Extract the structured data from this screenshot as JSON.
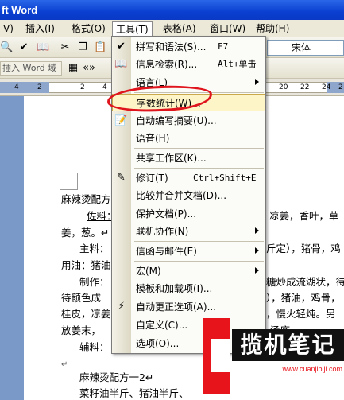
{
  "window": {
    "title": "ft Word"
  },
  "menubar": {
    "items": [
      {
        "label": "V)"
      },
      {
        "label": "插入(I)"
      },
      {
        "label": "格式(O)"
      },
      {
        "label": "工具(T)"
      },
      {
        "label": "表格(A)"
      },
      {
        "label": "窗口(W)"
      },
      {
        "label": "帮助(H)"
      }
    ]
  },
  "toolbar": {
    "font_name": "宋体",
    "insert_field_label": "插入 Word 域 ▾"
  },
  "ruler": {
    "left_ticks": [
      "4",
      "2"
    ],
    "marks": [
      "2",
      "4"
    ],
    "right_ticks": [
      "20",
      "22",
      "24",
      "2"
    ]
  },
  "tools_menu": {
    "items": [
      {
        "icon": "spelling-icon",
        "label": "拼写和语法(S)...",
        "shortcut": "F7"
      },
      {
        "icon": "research-icon",
        "label": "信息检索(R)...",
        "shortcut": "Alt+单击"
      },
      {
        "icon": "",
        "label": "语言(L)",
        "shortcut": "",
        "submenu": true
      },
      {
        "icon": "",
        "label": "字数统计(W)...",
        "shortcut": ""
      },
      {
        "icon": "autosummarize-icon",
        "label": "自动编写摘要(U)...",
        "shortcut": ""
      },
      {
        "icon": "",
        "label": "语音(H)",
        "shortcut": ""
      },
      {
        "icon": "",
        "label": "共享工作区(K)...",
        "shortcut": ""
      },
      {
        "icon": "track-changes-icon",
        "label": "修订(T)",
        "shortcut": "Ctrl+Shift+E"
      },
      {
        "icon": "",
        "label": "比较并合并文档(D)...",
        "shortcut": ""
      },
      {
        "icon": "",
        "label": "保护文档(P)...",
        "shortcut": ""
      },
      {
        "icon": "",
        "label": "联机协作(N)",
        "shortcut": "",
        "submenu": true
      },
      {
        "icon": "",
        "label": "信函与邮件(E)",
        "shortcut": "",
        "submenu": true
      },
      {
        "icon": "",
        "label": "宏(M)",
        "shortcut": "",
        "submenu": true
      },
      {
        "icon": "",
        "label": "模板和加载项(I)...",
        "shortcut": ""
      },
      {
        "icon": "autocorrect-icon",
        "label": "自动更正选项(A)...",
        "shortcut": ""
      },
      {
        "icon": "",
        "label": "自定义(C)...",
        "shortcut": ""
      },
      {
        "icon": "",
        "label": "选项(O)...",
        "shortcut": ""
      }
    ]
  },
  "document": {
    "lines": [
      "麻辣烫配方",
      "佐料：",
      "凉姜，香叶，草",
      "姜，葱。↵",
      "主料：",
      "斤定），猪骨，鸡",
      "用油：猪油",
      "制作：",
      "糖炒成流湖状，待",
      "待颜色成",
      "），猪油，鸡骨，",
      "桂皮，凉姜",
      "，慢火轻炖。另",
      "放姜末，",
      "汤底。",
      "辅料：",
      "↵",
      "麻辣烫配方一2↵",
      "菜籽油半斤、猪油半斤、"
    ]
  },
  "watermark": {
    "title": "揽机笔记",
    "url": "www.cuanjibiji.com"
  }
}
